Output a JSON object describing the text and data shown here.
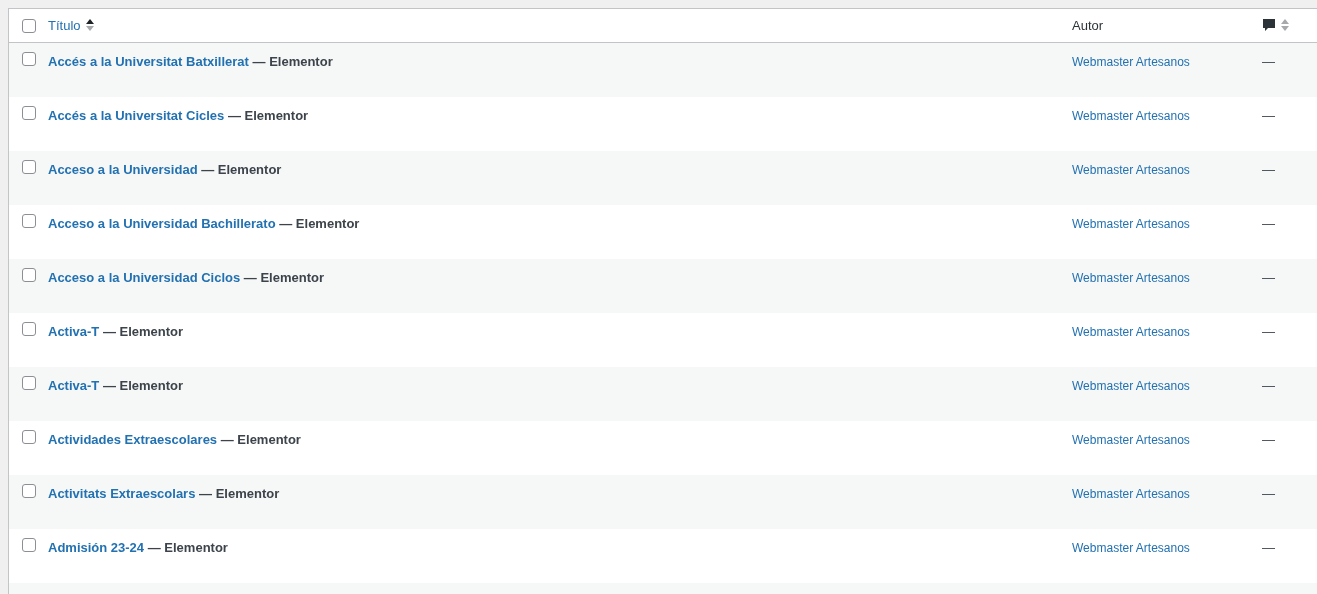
{
  "table": {
    "select_all": {
      "checked": false
    },
    "columns": [
      {
        "kind": "sortable",
        "label": "Título",
        "sort_active": true
      },
      {
        "kind": "plain",
        "label": "Autor"
      },
      {
        "kind": "comments-sortable",
        "sort_active": false
      }
    ],
    "rows": [
      {
        "checked": false,
        "title": "Accés a la Universitat Batxillerat",
        "state": "— Elementor",
        "author": "Webmaster Artesanos",
        "comments": "—"
      },
      {
        "checked": false,
        "title": "Accés a la Universitat Cicles",
        "state": "— Elementor",
        "author": "Webmaster Artesanos",
        "comments": "—"
      },
      {
        "checked": false,
        "title": "Acceso a la Universidad",
        "state": "— Elementor",
        "author": "Webmaster Artesanos",
        "comments": "—"
      },
      {
        "checked": false,
        "title": "Acceso a la Universidad Bachillerato",
        "state": "— Elementor",
        "author": "Webmaster Artesanos",
        "comments": "—"
      },
      {
        "checked": false,
        "title": "Acceso a la Universidad Ciclos",
        "state": "— Elementor",
        "author": "Webmaster Artesanos",
        "comments": "—"
      },
      {
        "checked": false,
        "title": "Activa-T",
        "state": "— Elementor",
        "author": "Webmaster Artesanos",
        "comments": "—"
      },
      {
        "checked": false,
        "title": "Activa-T",
        "state": "— Elementor",
        "author": "Webmaster Artesanos",
        "comments": "—"
      },
      {
        "checked": false,
        "title": "Actividades Extraescolares",
        "state": "— Elementor",
        "author": "Webmaster Artesanos",
        "comments": "—"
      },
      {
        "checked": false,
        "title": "Activitats Extraescolars",
        "state": "— Elementor",
        "author": "Webmaster Artesanos",
        "comments": "—"
      },
      {
        "checked": false,
        "title": "Admisión 23-24",
        "state": "— Elementor",
        "author": "Webmaster Artesanos",
        "comments": "—"
      }
    ]
  }
}
